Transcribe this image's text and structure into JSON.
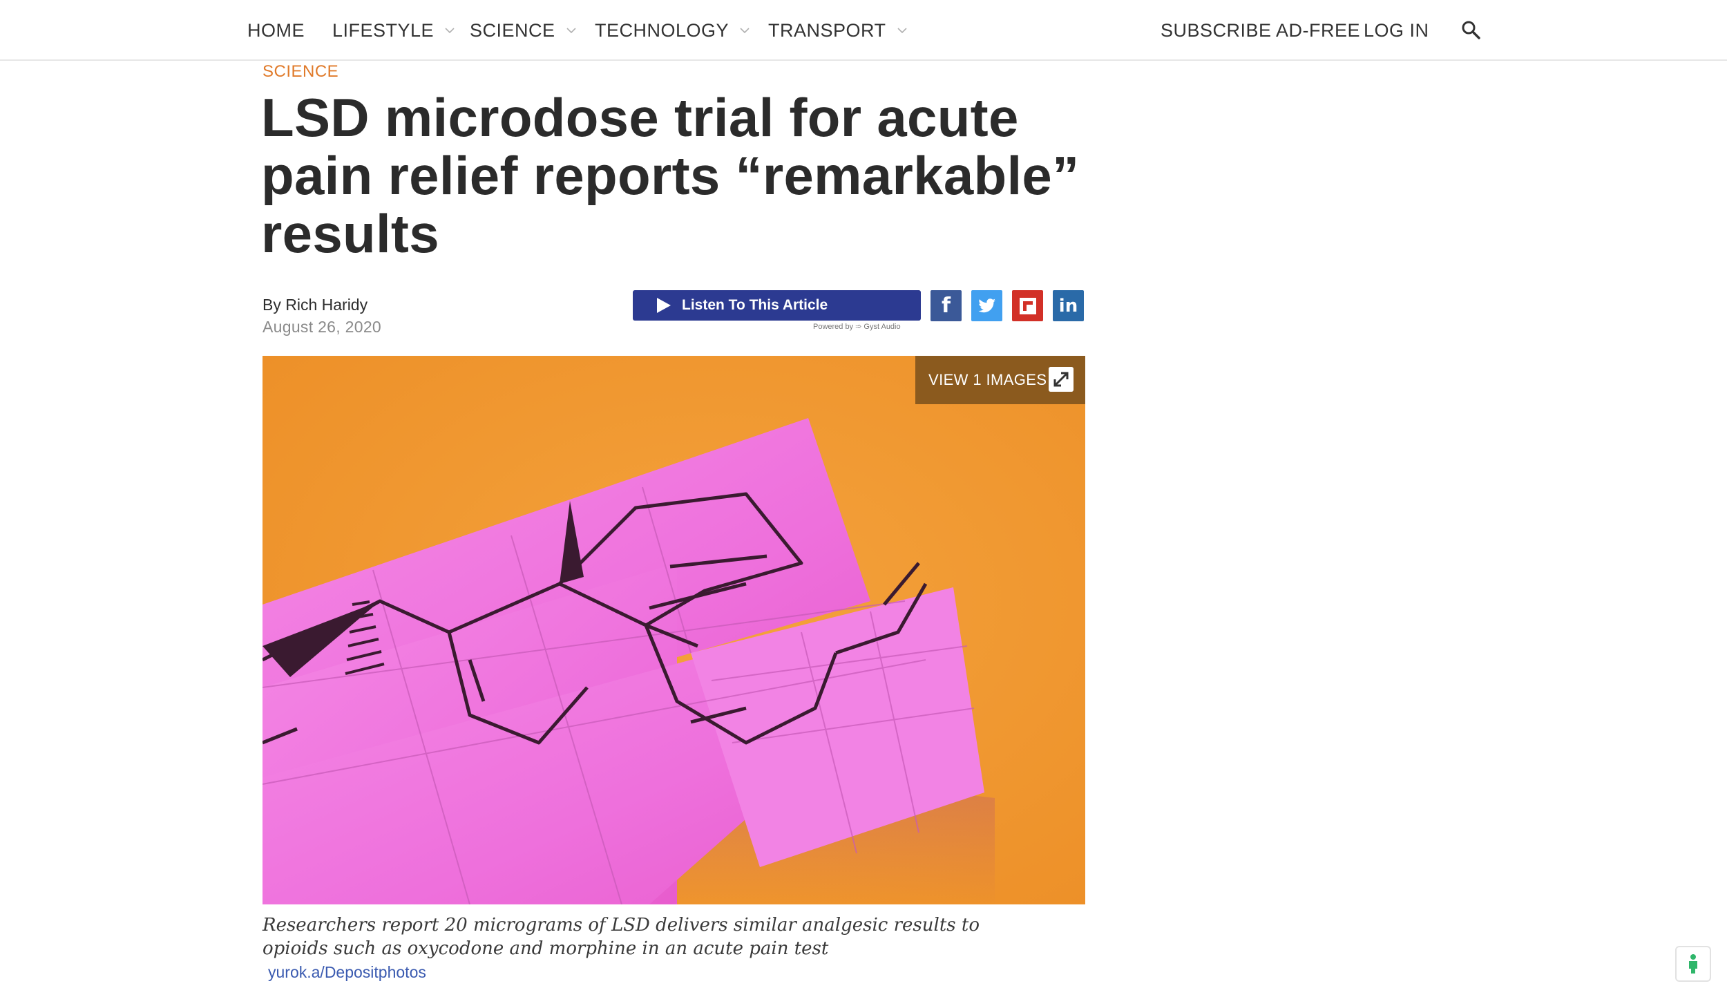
{
  "nav": {
    "home": "HOME",
    "lifestyle": "LIFESTYLE",
    "science": "SCIENCE",
    "technology": "TECHNOLOGY",
    "transport": "TRANSPORT",
    "subscribe": "SUBSCRIBE AD-FREE",
    "login": "LOG IN",
    "search_icon": "search-icon",
    "dropdown_icon": "chevron-down-icon"
  },
  "article": {
    "category": "SCIENCE",
    "headline": "LSD microdose trial for acute pain relief reports “remarkable” results",
    "byline_prefix": "By",
    "author": "Rich Haridy",
    "date": "August 26, 2020"
  },
  "audio": {
    "button_label": "Listen To This Article",
    "powered_by": "Powered by ➾ Gyst Audio"
  },
  "share": {
    "facebook": "f",
    "twitter_icon": "twitter-icon",
    "flipboard_icon": "flipboard-icon",
    "linkedin": "in"
  },
  "gallery": {
    "view_label": "VIEW 1 IMAGES",
    "expand_icon": "expand-icon"
  },
  "caption": {
    "text": "Researchers report 20 micrograms of LSD delivers similar analgesic results to opioids such as oxycodone and morphine in an acute pain test",
    "credit": "yurok.a/Depositphotos"
  },
  "colors": {
    "accent": "#e07a2a",
    "listen_button": "#2c3a91",
    "facebook": "#3b5998",
    "twitter": "#41a0f0",
    "flipboard": "#d23027",
    "linkedin": "#2a6aa8",
    "image_background": "#f0982f",
    "blotter": "#f07ae0",
    "overlay": "#8b5a1e",
    "credit_link": "#3a5ab0"
  }
}
